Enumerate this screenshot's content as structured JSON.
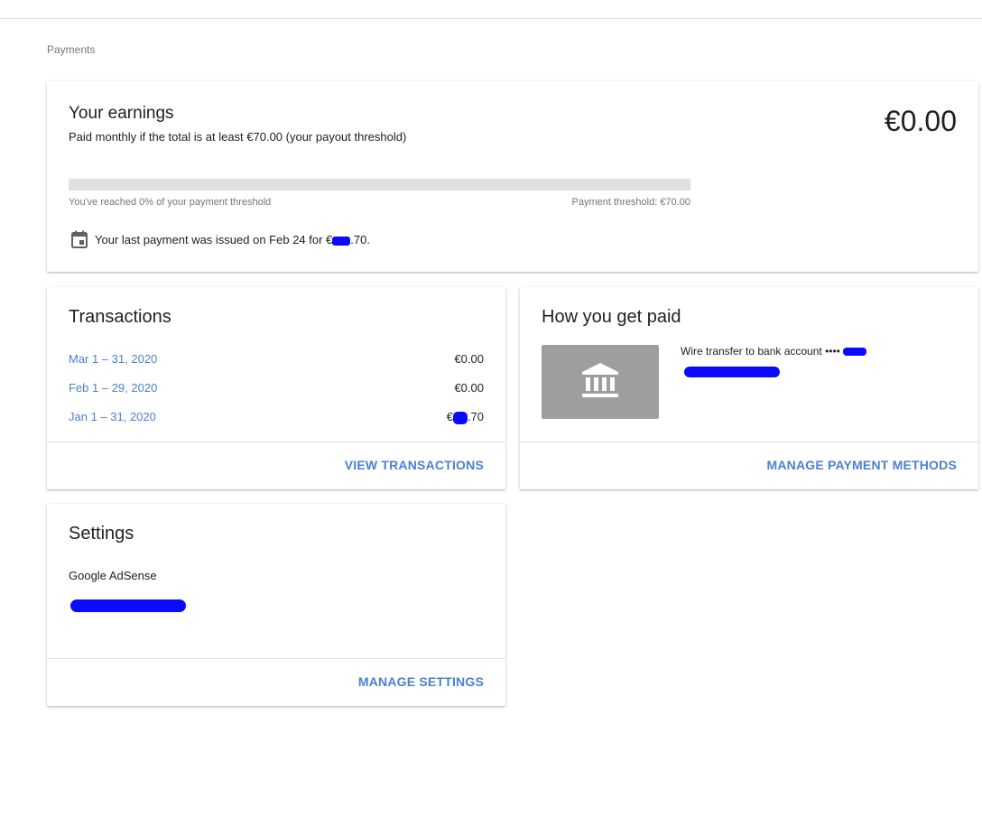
{
  "page": {
    "breadcrumb": "Payments"
  },
  "earnings": {
    "title": "Your earnings",
    "subtitle": "Paid monthly if the total is at least €70.00 (your payout threshold)",
    "amount": "€0.00",
    "progress_fraction": 0,
    "progress_label": "You've reached 0% of your payment threshold",
    "threshold_label": "Payment threshold: €70.00",
    "last_payment_prefix": "Your last payment was issued on Feb 24 for €",
    "last_payment_suffix": ".70.",
    "calendar_icon": "calendar-icon"
  },
  "transactions": {
    "title": "Transactions",
    "rows": [
      {
        "period": "Mar 1 – 31, 2020",
        "amount": "€0.00"
      },
      {
        "period": "Feb 1 – 29, 2020",
        "amount": "€0.00"
      },
      {
        "period": "Jan 1 – 31, 2020",
        "amount_prefix": "€",
        "amount_suffix": ".70"
      }
    ],
    "action": "VIEW TRANSACTIONS"
  },
  "payment_method": {
    "title": "How you get paid",
    "icon": "bank-icon",
    "method_text": "Wire transfer to bank account •••• ",
    "action": "MANAGE PAYMENT METHODS"
  },
  "settings": {
    "title": "Settings",
    "product": "Google AdSense",
    "action": "MANAGE SETTINGS"
  },
  "colors": {
    "accent": "#4a7fd6",
    "redaction": "#0a0aff",
    "bank_tile": "#9e9e9e",
    "progress_track": "#e0e0e0"
  }
}
